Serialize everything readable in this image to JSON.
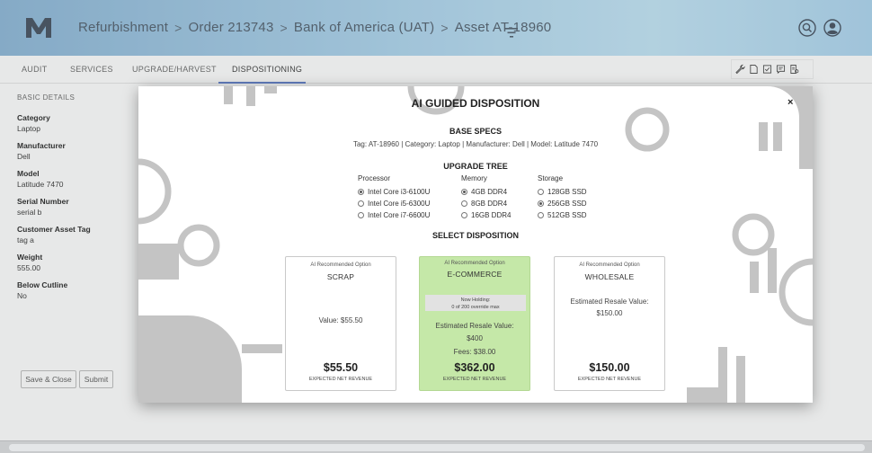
{
  "header": {
    "logo_text": "M",
    "breadcrumbs": [
      "Refurbishment",
      "Order 213743",
      "Bank of America (UAT)",
      "Asset AT-18960"
    ],
    "separator": ">"
  },
  "tabs": [
    {
      "label": "AUDIT"
    },
    {
      "label": "SERVICES"
    },
    {
      "label": "UPGRADE/HARVEST"
    },
    {
      "label": "DISPOSITIONING"
    }
  ],
  "details": {
    "section_title": "BASIC DETAILS",
    "fields": [
      {
        "label": "Category",
        "value": "Laptop"
      },
      {
        "label": "Manufacturer",
        "value": "Dell"
      },
      {
        "label": "Model",
        "value": "Latitude 7470"
      },
      {
        "label": "Serial Number",
        "value": "serial b"
      },
      {
        "label": "Customer Asset Tag",
        "value": "tag a"
      },
      {
        "label": "Weight",
        "value": "555.00"
      },
      {
        "label": "Below Cutline",
        "value": "No"
      }
    ],
    "save_close_label": "Save & Close",
    "submit_label": "Submit"
  },
  "modal": {
    "title": "AI GUIDED DISPOSITION",
    "close_label": "×",
    "base_specs_title": "BASE SPECS",
    "base_specs_text": "Tag: AT-18960 | Category: Laptop | Manufacturer: Dell | Model: Latitude 7470",
    "upgrade_tree_title": "UPGRADE TREE",
    "groups": [
      {
        "title": "Processor",
        "options": [
          {
            "label": "Intel Core i3-6100U",
            "selected": true
          },
          {
            "label": "Intel Core i5-6300U",
            "selected": false
          },
          {
            "label": "Intel Core i7-6600U",
            "selected": false
          }
        ]
      },
      {
        "title": "Memory",
        "options": [
          {
            "label": "4GB DDR4",
            "selected": true
          },
          {
            "label": "8GB DDR4",
            "selected": false
          },
          {
            "label": "16GB DDR4",
            "selected": false
          }
        ]
      },
      {
        "title": "Storage",
        "options": [
          {
            "label": "128GB SSD",
            "selected": false
          },
          {
            "label": "256GB SSD",
            "selected": true
          },
          {
            "label": "512GB SSD",
            "selected": false
          }
        ]
      }
    ],
    "select_title": "SELECT DISPOSITION",
    "cards": {
      "scrap": {
        "ai_label": "AI Recommended Option",
        "title": "SCRAP",
        "value_text": "Value: $55.50",
        "net": "$55.50",
        "net_label": "EXPECTED NET REVENUE"
      },
      "ecommerce": {
        "ai_label": "AI Recommended Option",
        "title": "E-COMMERCE",
        "holding_line1": "Now Holding:",
        "holding_line2": "0 of 200 override max",
        "resale_label": "Estimated Resale Value:",
        "resale_value": "$400",
        "fees": "Fees: $38.00",
        "net": "$362.00",
        "net_label": "EXPECTED NET REVENUE"
      },
      "wholesale": {
        "ai_label": "AI Recommended Option",
        "title": "WHOLESALE",
        "resale_label": "Estimated Resale Value:",
        "resale_value": "$150.00",
        "net": "$150.00",
        "net_label": "EXPECTED NET REVENUE"
      }
    }
  },
  "colors": {
    "header_gradient": [
      "#88b4d6",
      "#bfe3f5"
    ],
    "tab_accent": "#5a7bc8",
    "card_highlight": "#c5e8a8",
    "decor_gray": "#c4c4c4"
  },
  "icons": [
    "logo-icon",
    "filter-icon",
    "search-icon",
    "user-icon",
    "wrench-icon",
    "document-icon",
    "checkbox-icon",
    "comment-icon",
    "report-icon",
    "close-icon"
  ]
}
